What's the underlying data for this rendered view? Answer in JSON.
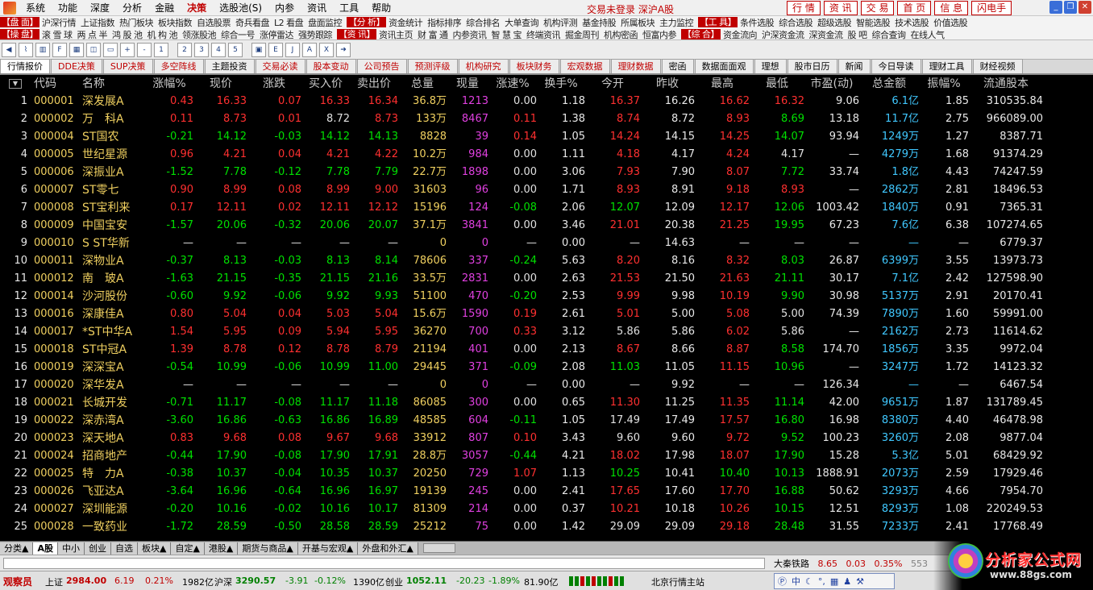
{
  "menu": {
    "items": [
      "系统",
      "功能",
      "深度",
      "分析",
      "金融",
      "决策",
      "选股池(S)",
      "内参",
      "资讯",
      "工具",
      "帮助"
    ],
    "active": "决策",
    "login_status": "交易未登录  深沪A股",
    "buttons": [
      "行 情",
      "资 讯",
      "交 易",
      "首 页",
      "信 息",
      "闪电手"
    ]
  },
  "funcbar": {
    "row1": [
      {
        "cat": "【盘 面】",
        "items": [
          "沪深行情",
          "上证指数",
          "热门板块",
          "板块指数",
          "自选股票",
          "奇兵看盘",
          "L2 看盘",
          "盘面监控"
        ]
      },
      {
        "cat": "【分 析】",
        "items": [
          "资金统计",
          "指标排序",
          "综合排名",
          "大单查询",
          "机构评测",
          "基金持股",
          "所属板块",
          "主力监控"
        ]
      },
      {
        "cat": "【工 具】",
        "items": [
          "条件选股",
          "综合选股",
          "超级选股",
          "智能选股",
          "技术选股",
          "价值选股"
        ]
      }
    ],
    "row2": [
      {
        "cat": "【操 盘】",
        "items": [
          "滚 雪 球",
          "两 点 半",
          "鸿 股 池",
          "机 构 池",
          "领涨股池",
          "综合一号",
          "涨停雷达",
          "强势跟踪"
        ]
      },
      {
        "cat": "【资 讯】",
        "items": [
          "资讯主页",
          "财 富 通",
          "内参资讯",
          "智 慧 宝",
          "终端资讯",
          "掘金周刊",
          "机构密函",
          "恒富内参"
        ]
      },
      {
        "cat": "【综 合】",
        "items": [
          "资金流向",
          "沪深资金流",
          "深资金流",
          "股 吧",
          "综合查询",
          "在线人气"
        ]
      }
    ]
  },
  "toolbar_icons": [
    "back-icon",
    "chart-icon",
    "kline-icon",
    "f10-icon",
    "grid-icon",
    "split-icon",
    "window-icon",
    "zoom-in-icon",
    "zoom-out-icon",
    "f1-icon",
    "sep",
    "f2-icon",
    "f3-icon",
    "f4-icon",
    "f5-icon",
    "sep",
    "folder-icon",
    "exp-icon",
    "jj-icon",
    "abc-icon",
    "ex-icon",
    "arrow-icon"
  ],
  "tabs": [
    {
      "label": "行情报价",
      "color": "black",
      "active": true
    },
    {
      "label": "DDE决策",
      "color": "red"
    },
    {
      "label": "SUP决策",
      "color": "red"
    },
    {
      "label": "多空阵线",
      "color": "red"
    },
    {
      "label": "主题投资",
      "color": "black"
    },
    {
      "label": "交易必读",
      "color": "red"
    },
    {
      "label": "股本变动",
      "color": "red"
    },
    {
      "label": "公司预告",
      "color": "red"
    },
    {
      "label": "预测评级",
      "color": "red"
    },
    {
      "label": "机构研究",
      "color": "red"
    },
    {
      "label": "板块财务",
      "color": "red"
    },
    {
      "label": "宏观数据",
      "color": "red"
    },
    {
      "label": "理财数据",
      "color": "red"
    },
    {
      "label": "密函",
      "color": "black"
    },
    {
      "label": "数据面面观",
      "color": "black"
    },
    {
      "label": "理想",
      "color": "black"
    },
    {
      "label": "股市日历",
      "color": "black"
    },
    {
      "label": "新闻",
      "color": "black"
    },
    {
      "label": "今日导读",
      "color": "black"
    },
    {
      "label": "理财工具",
      "color": "black"
    },
    {
      "label": "财经视频",
      "color": "black"
    }
  ],
  "columns": [
    "代码",
    "名称",
    "涨幅%",
    "现价",
    "涨跌",
    "买入价",
    "卖出价",
    "总量",
    "现量",
    "涨速%",
    "换手%",
    "今开",
    "昨收",
    "最高",
    "最低",
    "市盈(动)",
    "总金额",
    "振幅%",
    "流通股本"
  ],
  "rows": [
    [
      "000001",
      "深发展A",
      "0.43",
      "16.33",
      "0.07",
      "16.33",
      "16.34",
      "36.8万",
      "1213",
      "0.00",
      "1.18",
      "16.37",
      "16.26",
      "16.62",
      "16.32",
      "9.06",
      "6.1亿",
      "1.85",
      "310535.84"
    ],
    [
      "000002",
      "万　科A",
      "0.11",
      "8.73",
      "0.01",
      "8.72",
      "8.73",
      "133万",
      "8467",
      "0.11",
      "1.38",
      "8.74",
      "8.72",
      "8.93",
      "8.69",
      "13.18",
      "11.7亿",
      "2.75",
      "966089.00"
    ],
    [
      "000004",
      "ST国农",
      "-0.21",
      "14.12",
      "-0.03",
      "14.12",
      "14.13",
      "8828",
      "39",
      "0.14",
      "1.05",
      "14.24",
      "14.15",
      "14.25",
      "14.07",
      "93.94",
      "1249万",
      "1.27",
      "8387.71"
    ],
    [
      "000005",
      "世纪星源",
      "0.96",
      "4.21",
      "0.04",
      "4.21",
      "4.22",
      "10.2万",
      "984",
      "0.00",
      "1.11",
      "4.18",
      "4.17",
      "4.24",
      "4.17",
      "—",
      "4279万",
      "1.68",
      "91374.29"
    ],
    [
      "000006",
      "深振业A",
      "-1.52",
      "7.78",
      "-0.12",
      "7.78",
      "7.79",
      "22.7万",
      "1898",
      "0.00",
      "3.06",
      "7.93",
      "7.90",
      "8.07",
      "7.72",
      "33.74",
      "1.8亿",
      "4.43",
      "74247.59"
    ],
    [
      "000007",
      "ST零七",
      "0.90",
      "8.99",
      "0.08",
      "8.99",
      "9.00",
      "31603",
      "96",
      "0.00",
      "1.71",
      "8.93",
      "8.91",
      "9.18",
      "8.93",
      "—",
      "2862万",
      "2.81",
      "18496.53"
    ],
    [
      "000008",
      "ST宝利来",
      "0.17",
      "12.11",
      "0.02",
      "12.11",
      "12.12",
      "15196",
      "124",
      "-0.08",
      "2.06",
      "12.07",
      "12.09",
      "12.17",
      "12.06",
      "1003.42",
      "1840万",
      "0.91",
      "7365.31"
    ],
    [
      "000009",
      "中国宝安",
      "-1.57",
      "20.06",
      "-0.32",
      "20.06",
      "20.07",
      "37.1万",
      "3841",
      "0.00",
      "3.46",
      "21.01",
      "20.38",
      "21.25",
      "19.95",
      "67.23",
      "7.6亿",
      "6.38",
      "107274.65"
    ],
    [
      "000010",
      "S ST华新",
      "—",
      "—",
      "—",
      "—",
      "—",
      "0",
      "0",
      "—",
      "0.00",
      "—",
      "14.63",
      "—",
      "—",
      "—",
      "—",
      "—",
      "6779.37"
    ],
    [
      "000011",
      "深物业A",
      "-0.37",
      "8.13",
      "-0.03",
      "8.13",
      "8.14",
      "78606",
      "337",
      "-0.24",
      "5.63",
      "8.20",
      "8.16",
      "8.32",
      "8.03",
      "26.87",
      "6399万",
      "3.55",
      "13973.73"
    ],
    [
      "000012",
      "南　玻A",
      "-1.63",
      "21.15",
      "-0.35",
      "21.15",
      "21.16",
      "33.5万",
      "2831",
      "0.00",
      "2.63",
      "21.53",
      "21.50",
      "21.63",
      "21.11",
      "30.17",
      "7.1亿",
      "2.42",
      "127598.90"
    ],
    [
      "000014",
      "沙河股份",
      "-0.60",
      "9.92",
      "-0.06",
      "9.92",
      "9.93",
      "51100",
      "470",
      "-0.20",
      "2.53",
      "9.99",
      "9.98",
      "10.19",
      "9.90",
      "30.98",
      "5137万",
      "2.91",
      "20170.41"
    ],
    [
      "000016",
      "深康佳A",
      "0.80",
      "5.04",
      "0.04",
      "5.03",
      "5.04",
      "15.6万",
      "1590",
      "0.19",
      "2.61",
      "5.01",
      "5.00",
      "5.08",
      "5.00",
      "74.39",
      "7890万",
      "1.60",
      "59991.00"
    ],
    [
      "000017",
      "*ST中华A",
      "1.54",
      "5.95",
      "0.09",
      "5.94",
      "5.95",
      "36270",
      "700",
      "0.33",
      "3.12",
      "5.86",
      "5.86",
      "6.02",
      "5.86",
      "—",
      "2162万",
      "2.73",
      "11614.62"
    ],
    [
      "000018",
      "ST中冠A",
      "1.39",
      "8.78",
      "0.12",
      "8.78",
      "8.79",
      "21194",
      "401",
      "0.00",
      "2.13",
      "8.67",
      "8.66",
      "8.87",
      "8.58",
      "174.70",
      "1856万",
      "3.35",
      "9972.04"
    ],
    [
      "000019",
      "深深宝A",
      "-0.54",
      "10.99",
      "-0.06",
      "10.99",
      "11.00",
      "29445",
      "371",
      "-0.09",
      "2.08",
      "11.03",
      "11.05",
      "11.15",
      "10.96",
      "—",
      "3247万",
      "1.72",
      "14123.32"
    ],
    [
      "000020",
      "深华发A",
      "—",
      "—",
      "—",
      "—",
      "—",
      "0",
      "0",
      "—",
      "0.00",
      "—",
      "9.92",
      "—",
      "—",
      "126.34",
      "—",
      "—",
      "6467.54"
    ],
    [
      "000021",
      "长城开发",
      "-0.71",
      "11.17",
      "-0.08",
      "11.17",
      "11.18",
      "86085",
      "300",
      "0.00",
      "0.65",
      "11.30",
      "11.25",
      "11.35",
      "11.14",
      "42.00",
      "9651万",
      "1.87",
      "131789.45"
    ],
    [
      "000022",
      "深赤湾A",
      "-3.60",
      "16.86",
      "-0.63",
      "16.86",
      "16.89",
      "48585",
      "604",
      "-0.11",
      "1.05",
      "17.49",
      "17.49",
      "17.57",
      "16.80",
      "16.98",
      "8380万",
      "4.40",
      "46478.98"
    ],
    [
      "000023",
      "深天地A",
      "0.83",
      "9.68",
      "0.08",
      "9.67",
      "9.68",
      "33912",
      "807",
      "0.10",
      "3.43",
      "9.60",
      "9.60",
      "9.72",
      "9.52",
      "100.23",
      "3260万",
      "2.08",
      "9877.04"
    ],
    [
      "000024",
      "招商地产",
      "-0.44",
      "17.90",
      "-0.08",
      "17.90",
      "17.91",
      "28.8万",
      "3057",
      "-0.44",
      "4.21",
      "18.02",
      "17.98",
      "18.07",
      "17.90",
      "15.28",
      "5.3亿",
      "5.01",
      "68429.92"
    ],
    [
      "000025",
      "特　力A",
      "-0.38",
      "10.37",
      "-0.04",
      "10.35",
      "10.37",
      "20250",
      "729",
      "1.07",
      "1.13",
      "10.25",
      "10.41",
      "10.40",
      "10.13",
      "1888.91",
      "2073万",
      "2.59",
      "17929.46"
    ],
    [
      "000026",
      "飞亚达A",
      "-3.64",
      "16.96",
      "-0.64",
      "16.96",
      "16.97",
      "19139",
      "245",
      "0.00",
      "2.41",
      "17.65",
      "17.60",
      "17.70",
      "16.88",
      "50.62",
      "3293万",
      "4.66",
      "7954.70"
    ],
    [
      "000027",
      "深圳能源",
      "-0.20",
      "10.16",
      "-0.02",
      "10.16",
      "10.17",
      "81309",
      "214",
      "0.00",
      "0.37",
      "10.21",
      "10.18",
      "10.26",
      "10.15",
      "12.51",
      "8293万",
      "1.08",
      "220249.53"
    ],
    [
      "000028",
      "一致药业",
      "-1.72",
      "28.59",
      "-0.50",
      "28.58",
      "28.59",
      "25212",
      "75",
      "0.00",
      "1.42",
      "29.09",
      "29.09",
      "29.18",
      "28.48",
      "31.55",
      "7233万",
      "2.41",
      "17768.49"
    ]
  ],
  "bottom_tabs": [
    "分类▲",
    "A股",
    "中小",
    "创业",
    "自选",
    "板块▲",
    "自定▲",
    "港股▲",
    "期货与商品▲",
    "开基与宏观▲",
    "外盘和外汇▲"
  ],
  "bottom_active": "A股",
  "ticker": {
    "name": "大秦铁路",
    "price": "8.65",
    "change": "0.03",
    "pct": "0.35%",
    "vol": "553"
  },
  "status": {
    "brand": "观察员",
    "sh_label": "上证",
    "sh_val": "2984.00",
    "sh_chg": "6.19",
    "sh_pct": "0.21%",
    "sh_amt": "1982亿",
    "sz_label": "沪深",
    "sz_val": "3290.57",
    "sz_chg": "-3.91",
    "sz_pct": "-0.12%",
    "sz_amt": "1390亿",
    "cy_label": "创业",
    "cy_val": "1052.11",
    "cy_chg": "-20.23",
    "cy_pct": "-1.89%",
    "cy_amt": "81.90亿",
    "server": "北京行情主站"
  },
  "ime": {
    "label": "中"
  },
  "logo": {
    "title": "分析家公式网",
    "url": "www.88gs.com"
  }
}
